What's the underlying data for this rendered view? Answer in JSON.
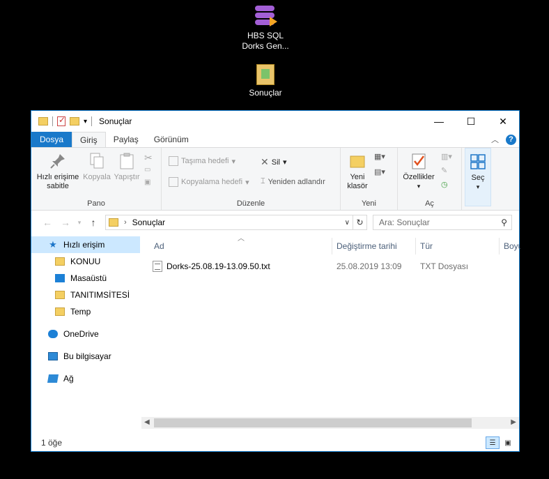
{
  "desktop": {
    "app_icon": {
      "label_line1": "HBS SQL",
      "label_line2": "Dorks Gen..."
    },
    "folder_icon": {
      "label": "Sonuçlar"
    }
  },
  "window": {
    "title": "Sonuçlar",
    "controls": {
      "minimize": "—",
      "maximize": "☐",
      "close": "✕"
    }
  },
  "tabs": {
    "file": "Dosya",
    "home": "Giriş",
    "share": "Paylaş",
    "view": "Görünüm",
    "help": "?"
  },
  "ribbon": {
    "pano": {
      "label": "Pano",
      "pin": "Hızlı erişime sabitle",
      "pin_line1": "Hızlı erişime",
      "pin_line2": "sabitle",
      "copy": "Kopyala",
      "paste": "Yapıştır"
    },
    "duzenle": {
      "label": "Düzenle",
      "move_to": "Taşıma hedefi",
      "copy_to": "Kopyalama hedefi",
      "delete": "Sil",
      "rename": "Yeniden adlandır"
    },
    "yeni": {
      "label": "Yeni",
      "new_folder_line1": "Yeni",
      "new_folder_line2": "klasör"
    },
    "ac": {
      "label": "Aç",
      "properties": "Özellikler"
    },
    "sec": {
      "label": "Seç"
    }
  },
  "address": {
    "path": "Sonuçlar",
    "search_placeholder": "Ara: Sonuçlar"
  },
  "nav": {
    "items": [
      {
        "label": "Hızlı erişim"
      },
      {
        "label": "KONUU"
      },
      {
        "label": "Masaüstü"
      },
      {
        "label": "TANITIMSİTESİ"
      },
      {
        "label": "Temp"
      },
      {
        "label": "OneDrive"
      },
      {
        "label": "Bu bilgisayar"
      },
      {
        "label": "Ağ"
      }
    ]
  },
  "columns": {
    "name": "Ad",
    "modified": "Değiştirme tarihi",
    "type": "Tür",
    "size": "Boyut"
  },
  "files": [
    {
      "name": "Dorks-25.08.19-13.09.50.txt",
      "modified": "25.08.2019 13:09",
      "type": "TXT Dosyası"
    }
  ],
  "status": {
    "count": "1 öğe"
  }
}
